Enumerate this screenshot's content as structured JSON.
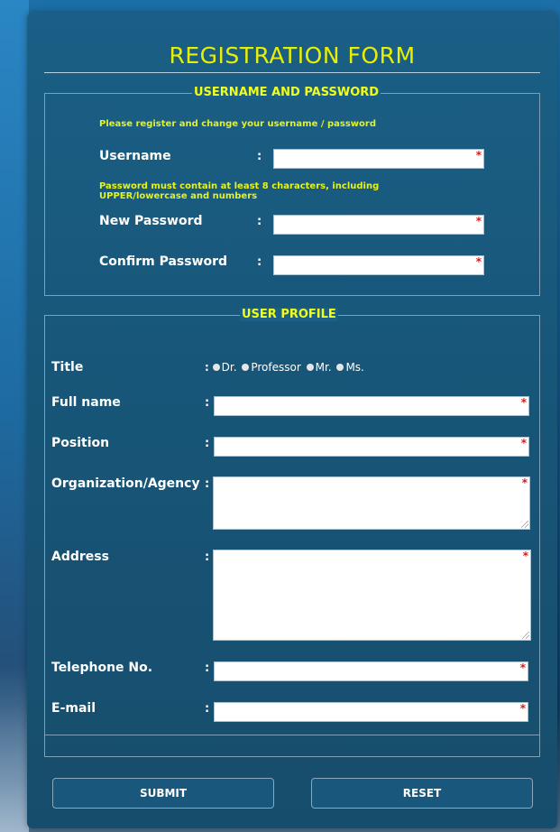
{
  "form": {
    "title": "REGISTRATION FORM"
  },
  "account_section": {
    "legend": "USERNAME AND PASSWORD",
    "note_register": "Please register and change your username / password",
    "username_label": "Username",
    "password_note_line1": "Password must contain at least 8 characters, including",
    "password_note_line2": "UPPER/lowercase and numbers",
    "new_password_label": "New Password",
    "confirm_password_label": "Confirm Password",
    "colon": ":",
    "required_mark": "*"
  },
  "profile_section": {
    "legend": "USER PROFILE",
    "title_label": "Title",
    "title_options": [
      "Dr.",
      "Professor",
      "Mr.",
      "Ms."
    ],
    "fullname_label": "Full name",
    "position_label": "Position",
    "organization_label": "Organization/Agency",
    "address_label": "Address",
    "telephone_label": "Telephone No.",
    "email_label": "E-mail",
    "colon": ":",
    "required_mark": "*"
  },
  "buttons": {
    "submit_label": "SUBMIT",
    "reset_label": "RESET"
  },
  "colors": {
    "title": "#e8f000",
    "legend": "#f2ff1a",
    "note": "#e4f220",
    "required": "#d81b1b",
    "panel": "#1b5f86"
  }
}
